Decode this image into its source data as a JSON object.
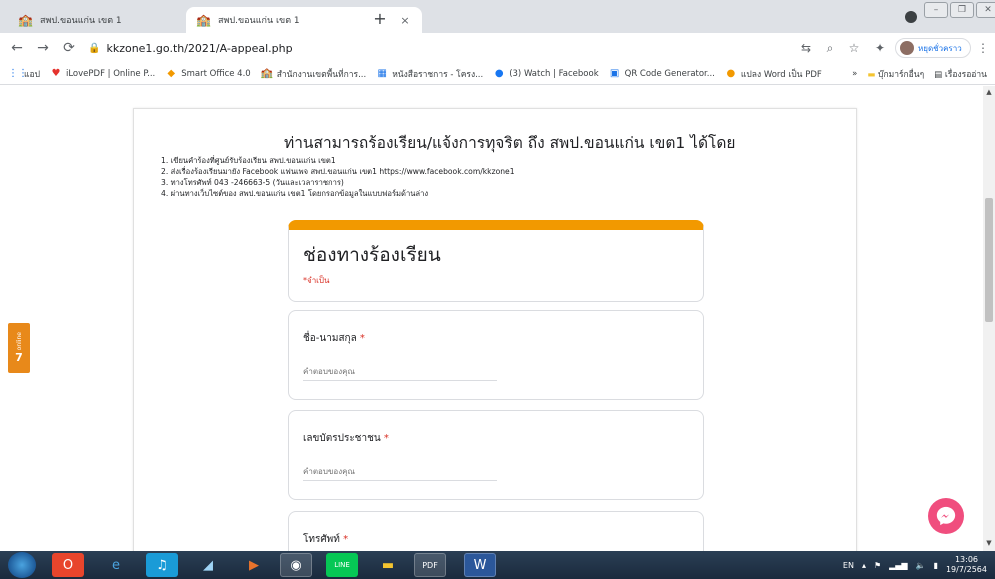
{
  "browser": {
    "tabs": [
      {
        "title": "สพป.ขอนแก่น เขต 1",
        "close": "×"
      },
      {
        "title": "สพป.ขอนแก่น เขต 1",
        "close": "×"
      }
    ],
    "new_tab": "+",
    "url": "kkzone1.go.th/2021/A-appeal.php",
    "profile_label": "หยุดชั่วคราว",
    "menu": "⋮"
  },
  "bookmarks": {
    "items": [
      {
        "icon": "apps-icon",
        "label": "แอป"
      },
      {
        "icon": "ilovepdf-icon",
        "label": "iLovePDF | Online P..."
      },
      {
        "icon": "smart-office-icon",
        "label": "Smart Office 4.0"
      },
      {
        "icon": "obec-icon",
        "label": "สำนักงานเขตพื้นที่การ..."
      },
      {
        "icon": "doc-icon",
        "label": "หนังสือราชการ - โครง..."
      },
      {
        "icon": "facebook-icon",
        "label": "(3) Watch | Facebook"
      },
      {
        "icon": "qr-icon",
        "label": "QR Code Generator..."
      },
      {
        "icon": "word-pdf-icon",
        "label": "แปลง Word เป็น PDF"
      }
    ],
    "overflow": "»",
    "other": "บุ๊กมาร์กอื่นๆ",
    "reading_list": "เรื่องรออ่าน"
  },
  "page": {
    "heading": "ท่านสามารถร้องเรียน/แจ้งการทุจริต ถึง สพป.ขอนแก่น เขต1 ได้โดย",
    "instructions": [
      "1. เขียนคำร้องที่ศูนย์รับร้องเรียน สพป.ขอนแก่น เขต1",
      "2. ส่งเรื่องร้องเรียนมายัง Facebook แฟนเพจ สพป.ขอนแก่น เขต1 https://www.facebook.com/kkzone1",
      "3. ทางโทรศัพท์ 043 -246663-5 (วันและเวลาราชการ)",
      "4. ผ่านทางเว็บไซต์ของ สพป.ขอนแก่น เขต1 โดยกรอกข้อมูลในแบบฟอร์มด้านล่าง"
    ],
    "form": {
      "title": "ช่องทางร้องเรียน",
      "required_note": "*จำเป็น",
      "questions": [
        {
          "label": "ชื่อ-นามสกุล",
          "star": "*",
          "placeholder": "คำตอบของคุณ"
        },
        {
          "label": "เลขบัตรประชาชน",
          "star": "*",
          "placeholder": "คำตอบของคุณ"
        },
        {
          "label": "โทรศัพท์",
          "star": "*"
        }
      ]
    },
    "online_badge": {
      "text": "online",
      "count": "7"
    }
  },
  "taskbar": {
    "lang": "EN",
    "time": "13:06",
    "date": "19/7/2564"
  }
}
